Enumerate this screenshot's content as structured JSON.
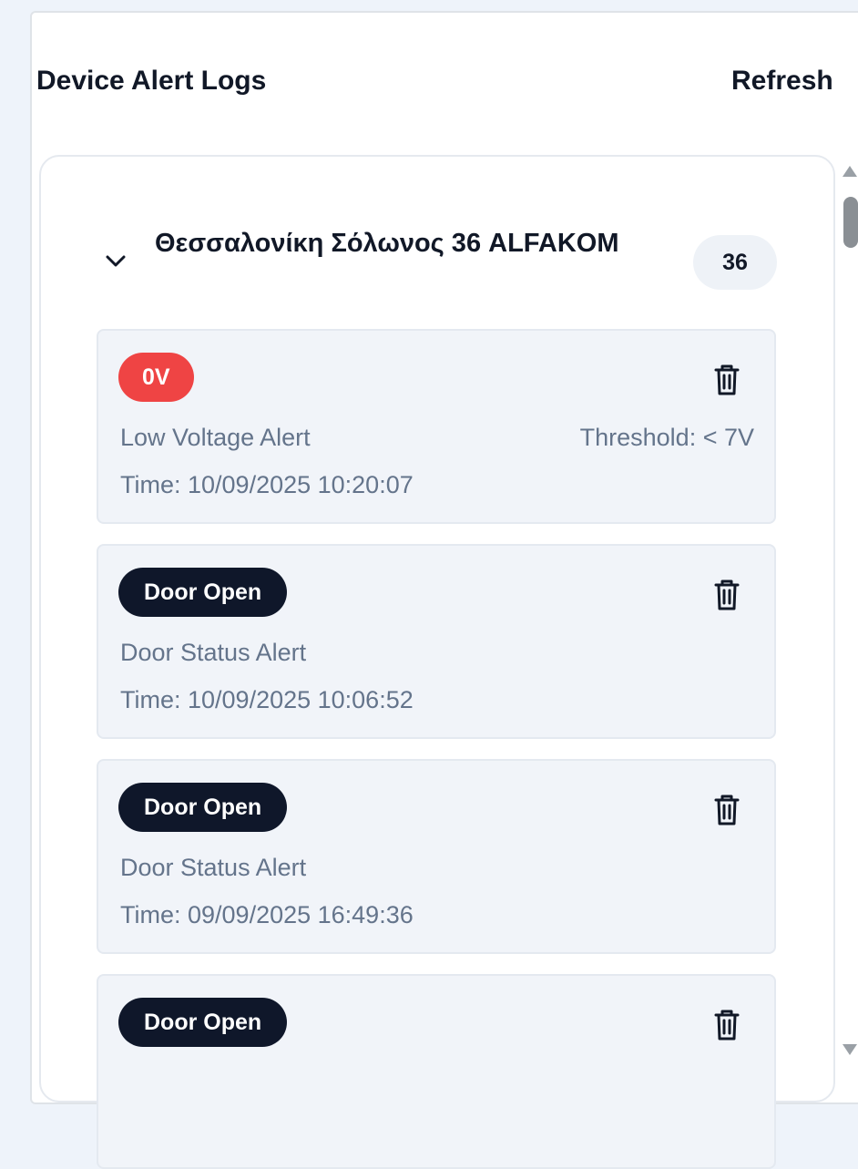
{
  "header": {
    "title": "Device Alert Logs",
    "refresh_label": "Refresh"
  },
  "group": {
    "title": "Θεσσαλονίκη Σόλωνος 36 ALFAKOM",
    "count": "36",
    "expanded": true,
    "chevron_icon": "chevron-down-icon"
  },
  "alerts": [
    {
      "badge": "0V",
      "badge_color": "#ef4444",
      "type": "Low Voltage Alert",
      "threshold": "Threshold: < 7V",
      "time": "Time: 10/09/2025 10:20:07",
      "delete_icon": "trash-icon"
    },
    {
      "badge": "Door Open",
      "badge_color": "#0f172a",
      "type": "Door Status Alert",
      "time": "Time: 10/09/2025 10:06:52",
      "delete_icon": "trash-icon"
    },
    {
      "badge": "Door Open",
      "badge_color": "#0f172a",
      "type": "Door Status Alert",
      "time": "Time: 09/09/2025 16:49:36",
      "delete_icon": "trash-icon"
    },
    {
      "badge": "Door Open",
      "badge_color": "#0f172a",
      "delete_icon": "trash-icon"
    }
  ]
}
